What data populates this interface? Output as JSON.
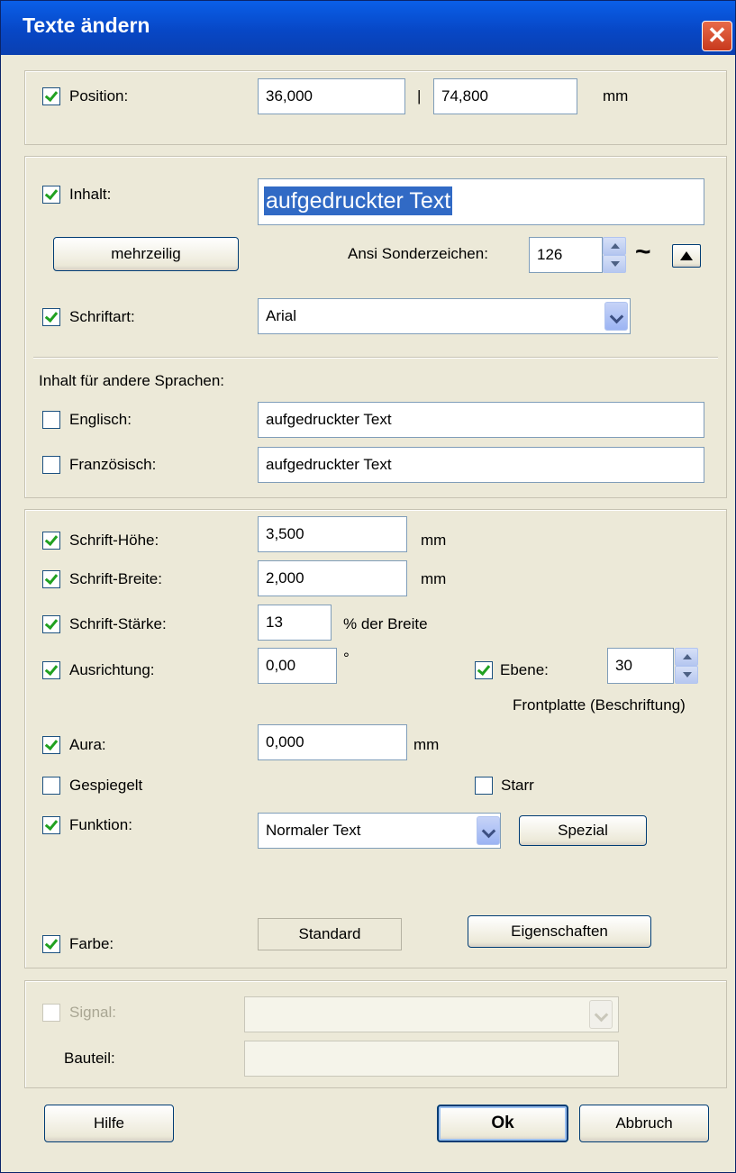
{
  "window": {
    "title": "Texte ändern",
    "close_glyph": "✕"
  },
  "position": {
    "label": "Position:",
    "x": "36,000",
    "separator": "|",
    "y": "74,800",
    "unit": "mm"
  },
  "inhalt": {
    "label": "Inhalt:",
    "value": "aufgedruckter Text"
  },
  "mehrzeilig_button": "mehrzeilig",
  "ansi": {
    "label": "Ansi Sonderzeichen:",
    "value": "126",
    "char": "~"
  },
  "schriftart": {
    "label": "Schriftart:",
    "value": "Arial"
  },
  "languages": {
    "heading": "Inhalt für andere Sprachen:",
    "english": {
      "label": "Englisch:",
      "value": "aufgedruckter Text"
    },
    "french": {
      "label": "Französisch:",
      "value": "aufgedruckter Text"
    }
  },
  "hoehe": {
    "label": "Schrift-Höhe:",
    "value": "3,500",
    "unit": "mm"
  },
  "breite": {
    "label": "Schrift-Breite:",
    "value": "2,000",
    "unit": "mm"
  },
  "staerke": {
    "label": "Schrift-Stärke:",
    "value": "13",
    "unit": "% der Breite"
  },
  "ausrichtung": {
    "label": "Ausrichtung:",
    "value": "0,00",
    "unit": "°"
  },
  "ebene": {
    "label": "Ebene:",
    "value": "30",
    "desc": "Frontplatte (Beschriftung)"
  },
  "aura": {
    "label": "Aura:",
    "value": "0,000",
    "unit": "mm"
  },
  "gespiegelt": {
    "label": "Gespiegelt"
  },
  "starr": {
    "label": "Starr"
  },
  "funktion": {
    "label": "Funktion:",
    "value": "Normaler Text",
    "spezial": "Spezial"
  },
  "farbe": {
    "label": "Farbe:",
    "value": "Standard",
    "eigenschaften": "Eigenschaften"
  },
  "signal": {
    "label": "Signal:",
    "value": ""
  },
  "bauteil": {
    "label": "Bauteil:",
    "value": ""
  },
  "buttons": {
    "help": "Hilfe",
    "ok": "Ok",
    "cancel": "Abbruch"
  }
}
